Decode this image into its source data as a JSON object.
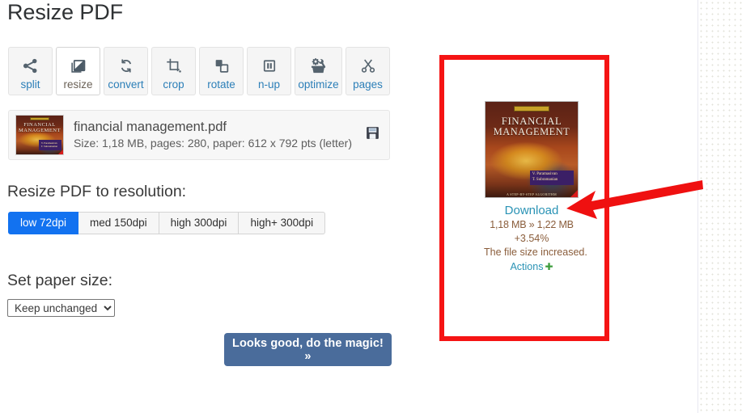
{
  "page": {
    "title": "Resize PDF"
  },
  "toolbar": {
    "items": [
      {
        "label": "split",
        "icon": "share-nodes-icon",
        "active": false
      },
      {
        "label": "resize",
        "icon": "resize-image-icon",
        "active": true
      },
      {
        "label": "convert",
        "icon": "refresh-arrows-icon",
        "active": false
      },
      {
        "label": "crop",
        "icon": "crop-icon",
        "active": false
      },
      {
        "label": "rotate",
        "icon": "rotate-pages-icon",
        "active": false
      },
      {
        "label": "n-up",
        "icon": "columns-icon",
        "active": false
      },
      {
        "label": "optimize",
        "icon": "toolbox-gear-icon",
        "active": false
      },
      {
        "label": "pages",
        "icon": "scissors-icon",
        "active": false
      }
    ]
  },
  "file": {
    "name": "financial management.pdf",
    "details": "Size: 1,18 MB, pages: 280, paper: 612 x 792 pts (letter)",
    "save_icon": "floppy-disk-icon",
    "thumb_title_line1": "FINANCIAL",
    "thumb_title_line2": "MANAGEMENT"
  },
  "resolution": {
    "heading": "Resize PDF to resolution:",
    "options": [
      {
        "label": "low 72dpi",
        "selected": true
      },
      {
        "label": "med 150dpi",
        "selected": false
      },
      {
        "label": "high 300dpi",
        "selected": false
      },
      {
        "label": "high+ 300dpi",
        "selected": false
      }
    ]
  },
  "paper": {
    "heading": "Set paper size:",
    "selected": "Keep unchanged",
    "options": [
      "Keep unchanged"
    ]
  },
  "submit": {
    "label": "Looks good, do the magic! »"
  },
  "result": {
    "thumb_title_line1": "FINANCIAL",
    "thumb_title_line2": "MANAGEMENT",
    "thumb_authors": "V. Paramasivan\nT. Subramanian",
    "thumb_footer": "A STEP-BY-STEP ALGORITHM",
    "download_label": "Download",
    "size_change": "1,18 MB » 1,22 MB",
    "percent_change": "+3.54%",
    "message": "The file size increased.",
    "actions_label": "Actions",
    "actions_plus": "✚"
  },
  "annotations": {
    "highlight_box": {
      "color": "#f51414",
      "shape": "rectangle"
    },
    "arrow": {
      "color": "#ef1010",
      "shape": "arrow",
      "points_to": "Download"
    }
  },
  "colors": {
    "accent_blue": "#1272f0",
    "link_blue": "#2a93b5",
    "tool_link": "#2c7fb8",
    "submit_bg": "#4a6c9b",
    "stat_brown": "#8a5d3b",
    "annotation_red": "#f51414"
  }
}
